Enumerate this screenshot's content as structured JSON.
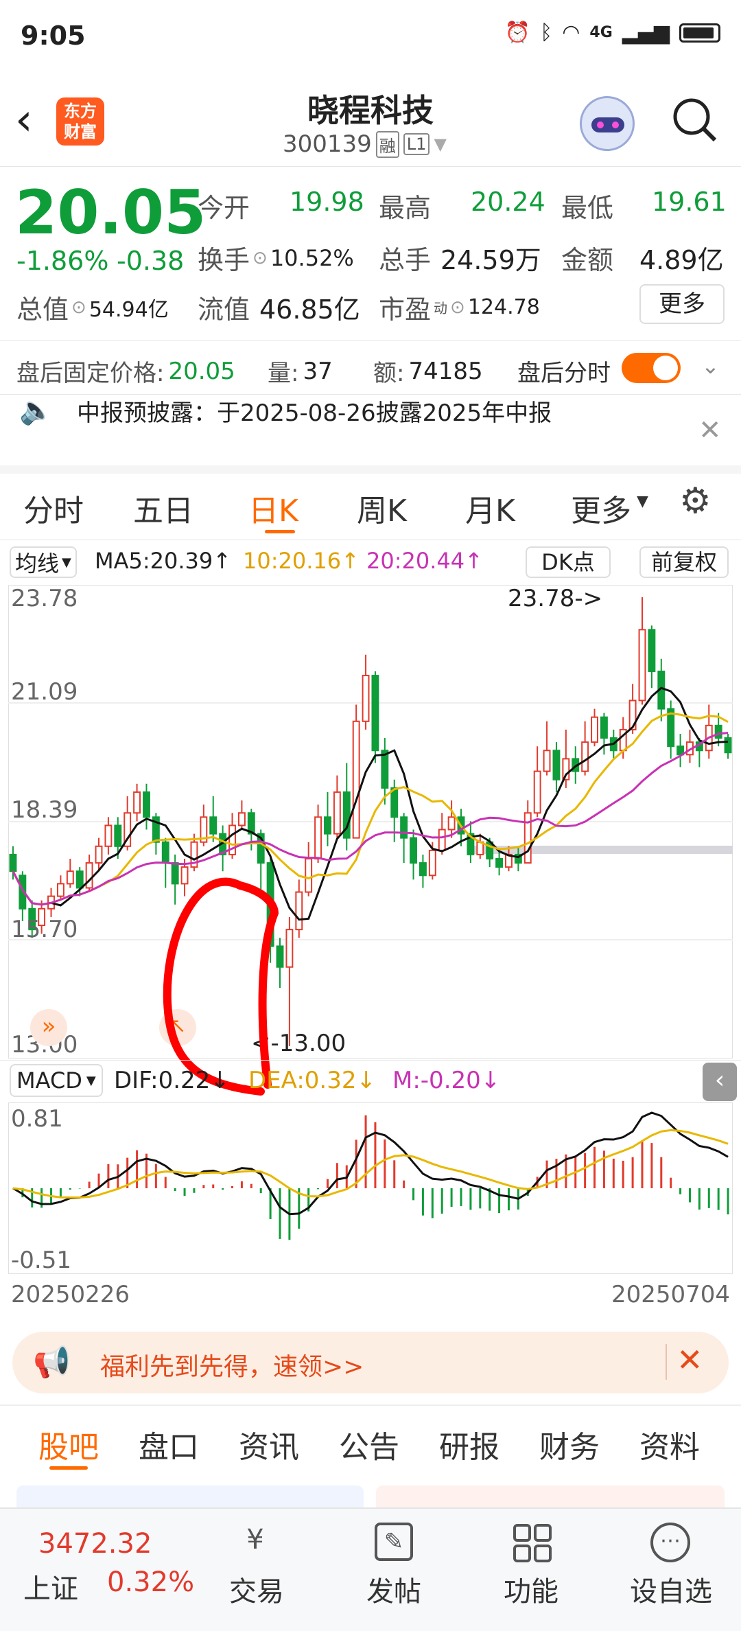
{
  "status": {
    "time": "9:05",
    "net": "4G"
  },
  "header": {
    "title": "晓程科技",
    "code": "300139",
    "tag1": "融",
    "tag2": "L1",
    "logo_line1": "东方",
    "logo_line2": "财富"
  },
  "quote": {
    "price": "20.05",
    "change_pct": "-1.86%",
    "change": "-0.38",
    "open_label": "今开",
    "open": "19.98",
    "high_label": "最高",
    "high": "20.24",
    "low_label": "最低",
    "low": "19.61",
    "turnover_label": "换手",
    "turnover": "10.52%",
    "volume_label": "总手",
    "volume": "24.59万",
    "amount_label": "金额",
    "amount": "4.89亿",
    "mcap_label": "总值",
    "mcap": "54.94亿",
    "float_label": "流值",
    "float": "46.85亿",
    "pe_label": "市盈",
    "pe_sup": "动",
    "pe": "124.78",
    "more": "更多"
  },
  "after_hours": {
    "price_label": "盘后固定价格:",
    "price": "20.05",
    "vol_label": "量:",
    "vol": "37",
    "amt_label": "额:",
    "amt": "74185",
    "toggle_label": "盘后分时"
  },
  "notice": {
    "text": "中报预披露：于2025-08-26披露2025年中报"
  },
  "tabs": [
    "分时",
    "五日",
    "日K",
    "周K",
    "月K",
    "更多"
  ],
  "chart_toolbar": {
    "ma_select": "均线",
    "ma5": "MA5:20.39↑",
    "ma10": "10:20.16↑",
    "ma20": "20:20.44↑",
    "dk": "DK点",
    "adjust": "前复权"
  },
  "price_axis": [
    "23.78",
    "21.09",
    "18.39",
    "15.70",
    "13.00"
  ],
  "annotations": {
    "high": "23.78->",
    "low": "<-13.00"
  },
  "macd_bar": {
    "select": "MACD",
    "dif": "DIF:0.22↓",
    "dea": "DEA:0.32↓",
    "m": "M:-0.20↓"
  },
  "macd_axis": {
    "top": "0.81",
    "bottom": "-0.51"
  },
  "date_range": {
    "start": "20250226",
    "end": "20250704"
  },
  "promo": {
    "text": "福利先到先得，速领>>"
  },
  "bottom_tabs": [
    "股吧",
    "盘口",
    "资讯",
    "公告",
    "研报",
    "财务",
    "资料"
  ],
  "nav": {
    "index_value": "3472.32",
    "index_name": "上证",
    "index_change": "0.32%",
    "items": [
      "交易",
      "发帖",
      "功能",
      "设自选"
    ]
  },
  "colors": {
    "up": "#e23a2c",
    "down": "#0f9d3a",
    "accent": "#ff6a00",
    "ma10": "#e0a000",
    "ma20": "#c832b4"
  },
  "chart_data": {
    "type": "candlestick",
    "yrange": [
      13.0,
      23.78
    ],
    "candles": [
      [
        17.6,
        17.2,
        17.8,
        17.0
      ],
      [
        17.1,
        16.3,
        17.2,
        16.0
      ],
      [
        16.3,
        15.8,
        16.5,
        15.6
      ],
      [
        15.9,
        16.3,
        16.5,
        15.7
      ],
      [
        16.3,
        16.6,
        16.8,
        16.1
      ],
      [
        16.6,
        16.9,
        17.1,
        16.5
      ],
      [
        16.9,
        17.2,
        17.5,
        16.8
      ],
      [
        17.2,
        16.8,
        17.3,
        16.6
      ],
      [
        16.8,
        17.4,
        17.6,
        16.7
      ],
      [
        17.4,
        17.8,
        18.0,
        17.2
      ],
      [
        17.8,
        18.3,
        18.5,
        17.6
      ],
      [
        18.3,
        17.8,
        18.5,
        17.5
      ],
      [
        17.8,
        18.6,
        19.0,
        17.7
      ],
      [
        18.6,
        19.1,
        19.3,
        18.4
      ],
      [
        19.1,
        18.5,
        19.3,
        18.2
      ],
      [
        18.5,
        17.9,
        18.6,
        17.6
      ],
      [
        17.9,
        17.4,
        18.0,
        16.8
      ],
      [
        17.4,
        16.9,
        17.6,
        16.4
      ],
      [
        16.9,
        17.3,
        17.5,
        16.6
      ],
      [
        17.3,
        17.9,
        18.1,
        17.2
      ],
      [
        17.9,
        18.5,
        18.8,
        17.8
      ],
      [
        18.5,
        18.1,
        19.0,
        17.9
      ],
      [
        18.1,
        17.6,
        18.3,
        17.2
      ],
      [
        17.6,
        18.3,
        18.6,
        17.5
      ],
      [
        18.3,
        18.6,
        18.9,
        18.2
      ],
      [
        18.6,
        18.1,
        18.7,
        17.7
      ],
      [
        18.1,
        17.4,
        18.2,
        16.6
      ],
      [
        17.4,
        15.4,
        17.6,
        15.0
      ],
      [
        15.4,
        14.9,
        15.6,
        14.4
      ],
      [
        14.9,
        15.8,
        16.1,
        13.0
      ],
      [
        15.8,
        16.7,
        17.0,
        15.6
      ],
      [
        16.7,
        17.5,
        17.9,
        16.6
      ],
      [
        17.5,
        18.5,
        18.8,
        17.4
      ],
      [
        18.5,
        18.1,
        19.1,
        17.8
      ],
      [
        18.1,
        19.1,
        19.5,
        18.0
      ],
      [
        19.1,
        18.0,
        19.8,
        17.7
      ],
      [
        18.0,
        20.8,
        21.2,
        18.0
      ],
      [
        20.8,
        21.9,
        22.4,
        20.6
      ],
      [
        21.9,
        20.1,
        22.0,
        19.8
      ],
      [
        20.1,
        19.2,
        20.4,
        18.8
      ],
      [
        19.2,
        18.5,
        19.4,
        17.9
      ],
      [
        18.5,
        18.0,
        18.6,
        17.4
      ],
      [
        18.0,
        17.4,
        18.2,
        17.0
      ],
      [
        17.4,
        17.1,
        17.6,
        16.8
      ],
      [
        17.1,
        17.7,
        17.9,
        17.0
      ],
      [
        17.7,
        18.2,
        18.6,
        17.6
      ],
      [
        18.2,
        18.5,
        18.9,
        18.0
      ],
      [
        18.5,
        18.1,
        18.7,
        17.8
      ],
      [
        18.1,
        17.6,
        18.4,
        17.4
      ],
      [
        17.6,
        17.9,
        18.1,
        17.5
      ],
      [
        17.9,
        17.5,
        18.0,
        17.3
      ],
      [
        17.5,
        17.3,
        17.7,
        17.1
      ],
      [
        17.3,
        17.6,
        17.8,
        17.2
      ],
      [
        17.6,
        17.4,
        17.8,
        17.2
      ],
      [
        17.4,
        18.6,
        18.9,
        17.4
      ],
      [
        18.6,
        19.6,
        20.2,
        18.5
      ],
      [
        19.6,
        20.1,
        20.8,
        19.5
      ],
      [
        20.1,
        19.4,
        20.3,
        19.1
      ],
      [
        19.4,
        19.9,
        20.6,
        19.2
      ],
      [
        19.9,
        19.6,
        20.2,
        19.3
      ],
      [
        19.6,
        20.3,
        20.8,
        19.5
      ],
      [
        20.3,
        20.9,
        21.1,
        20.2
      ],
      [
        20.9,
        20.4,
        21.0,
        20.0
      ],
      [
        20.4,
        20.1,
        20.6,
        19.9
      ],
      [
        20.1,
        20.6,
        20.9,
        19.9
      ],
      [
        20.6,
        21.3,
        21.7,
        20.5
      ],
      [
        21.3,
        23.0,
        23.78,
        21.2
      ],
      [
        23.0,
        22.0,
        23.1,
        21.6
      ],
      [
        22.0,
        21.1,
        22.3,
        20.8
      ],
      [
        21.1,
        20.2,
        21.3,
        19.9
      ],
      [
        20.2,
        20.0,
        20.5,
        19.7
      ],
      [
        20.0,
        20.3,
        20.6,
        19.8
      ],
      [
        20.3,
        20.1,
        20.4,
        19.7
      ],
      [
        20.1,
        20.7,
        21.2,
        19.9
      ],
      [
        20.7,
        20.4,
        21.0,
        20.2
      ],
      [
        20.4,
        20.05,
        20.5,
        19.9
      ]
    ],
    "macd_range": [
      -0.51,
      0.81
    ]
  }
}
